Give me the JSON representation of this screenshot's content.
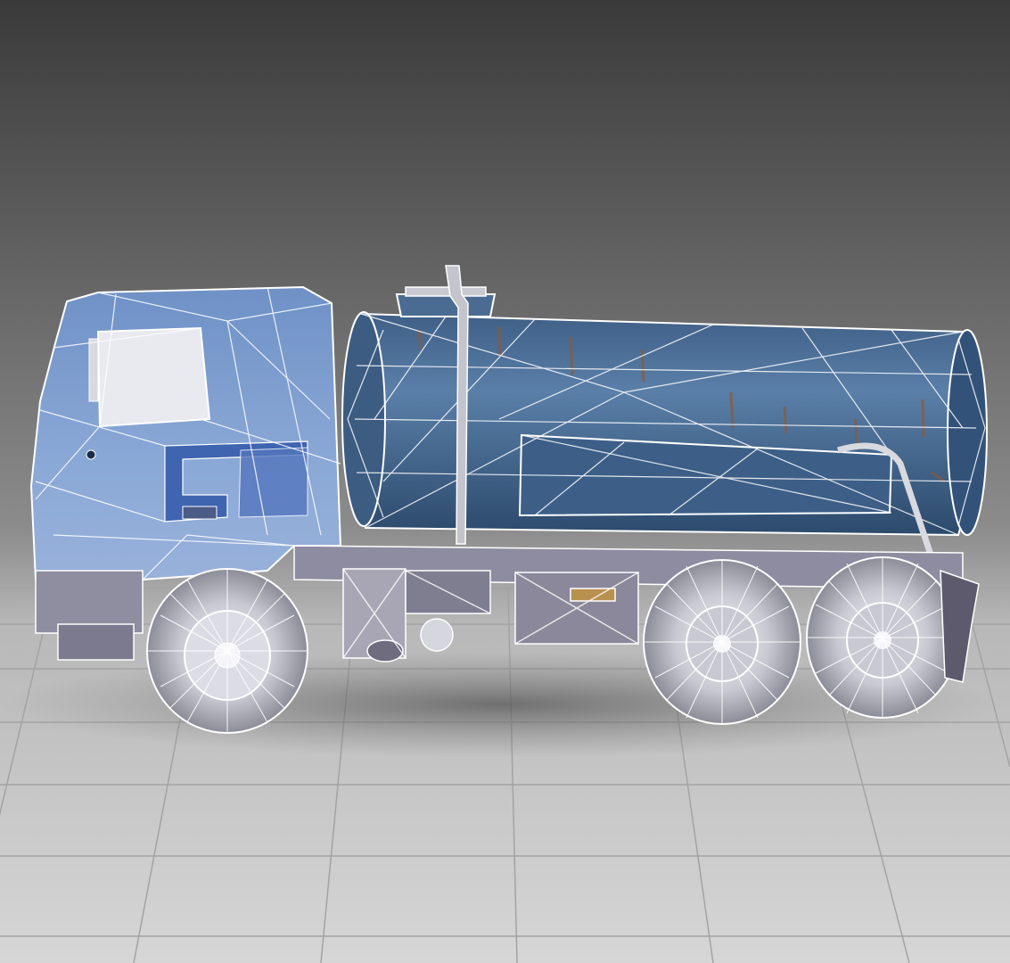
{
  "scene": {
    "subject": "tanker-truck-wireframe-render",
    "colors": {
      "background_top": "#3e3e3e",
      "background_mid": "#8a8a8a",
      "floor": "#c9c9c9",
      "floor_grid": "#9c9c9c",
      "cab_blue": "#7e9fd0",
      "cab_stripe": "#3f64b0",
      "tank_blue": "#4a6f96",
      "tank_dark": "#2f4f72",
      "rust": "#8a5a3a",
      "chassis": "#9a98a8",
      "wireframe": "#ffffff",
      "tire": "#cfcfd8"
    },
    "icons": {
      "cab": "truck-cab-icon",
      "tank": "tank-icon",
      "wheel": "wheel-icon"
    }
  }
}
